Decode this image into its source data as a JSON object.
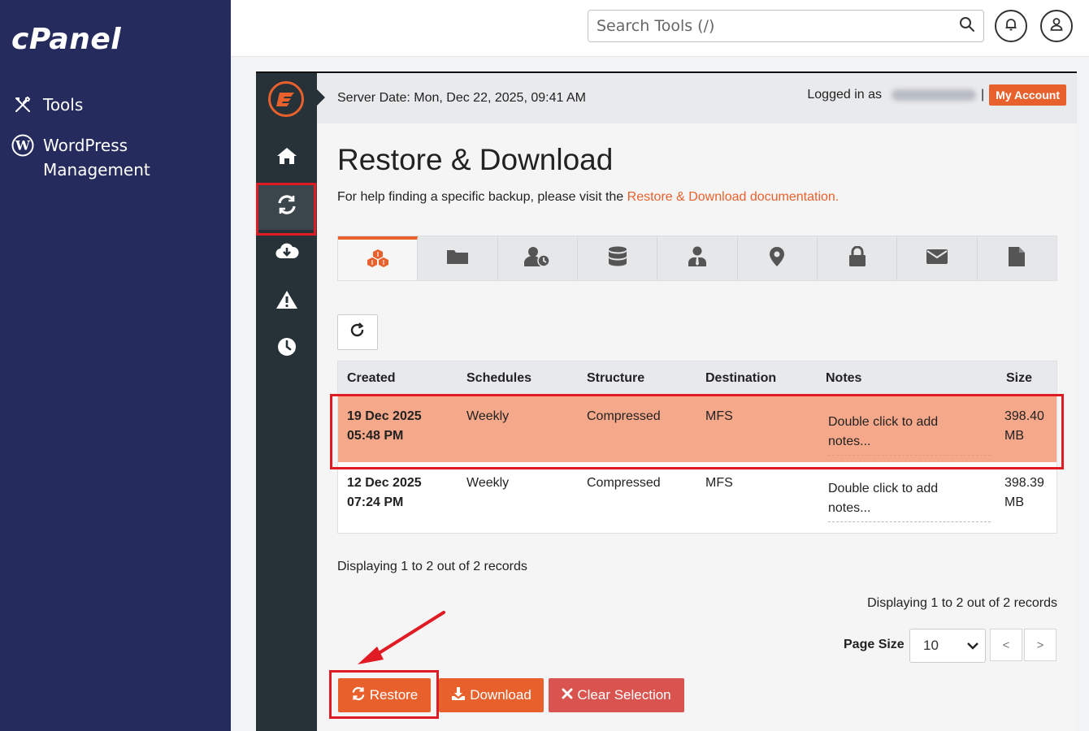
{
  "sidebar": {
    "logo": "cPanel",
    "items": [
      {
        "label": "Tools",
        "icon": "tools-icon"
      },
      {
        "label": "WordPress\nManagement",
        "icon": "wordpress-icon"
      }
    ]
  },
  "topbar": {
    "search_placeholder": "Search Tools (/)",
    "icons": [
      "search-icon",
      "bell-icon",
      "user-icon"
    ]
  },
  "jetbackup": {
    "rail_icons": [
      "home-icon",
      "restore-icon",
      "cloud-download-icon",
      "warning-icon",
      "clock-icon"
    ],
    "active_rail_item": "restore-icon",
    "server_date": "Server Date: Mon, Dec 22, 2025, 09:41 AM",
    "logged_in_label": "Logged in as",
    "logged_in_separator": "|",
    "my_account": "My Account",
    "title": "Restore & Download",
    "help_text": "For help finding a specific backup, please visit the ",
    "help_link": "Restore & Download documentation.",
    "tabs": [
      "cubes-icon",
      "folder-icon",
      "user-clock-icon",
      "database-icon",
      "user-tie-icon",
      "location-pin-icon",
      "lock-icon",
      "envelope-icon",
      "file-icon"
    ],
    "active_tab": 0,
    "table": {
      "headers": [
        "Created",
        "Schedules",
        "Structure",
        "Destination",
        "Notes",
        "Size"
      ],
      "rows": [
        {
          "created": "19 Dec 2025\n05:48 PM",
          "schedule": "Weekly",
          "structure": "Compressed",
          "destination": "MFS",
          "notes": "Double click to add\nnotes...",
          "size": "398.40\nMB",
          "selected": true
        },
        {
          "created": "12 Dec 2025\n07:24 PM",
          "schedule": "Weekly",
          "structure": "Compressed",
          "destination": "MFS",
          "notes": "Double click to add\nnotes...",
          "size": "398.39\nMB",
          "selected": false
        }
      ]
    },
    "display_text": "Displaying 1 to 2 out of 2 records",
    "display_text_right": "Displaying 1 to 2 out of 2 records",
    "page_size_label": "Page Size",
    "page_size": "10",
    "prev": "<",
    "next": ">",
    "buttons": {
      "restore": "Restore",
      "download": "Download",
      "clear": "Clear Selection"
    }
  },
  "colors": {
    "sidebar_bg": "#252b5c",
    "accent": "#e8612c",
    "selected_row": "#f6a88a",
    "danger": "#d9534f",
    "highlight": "#e01b24"
  }
}
